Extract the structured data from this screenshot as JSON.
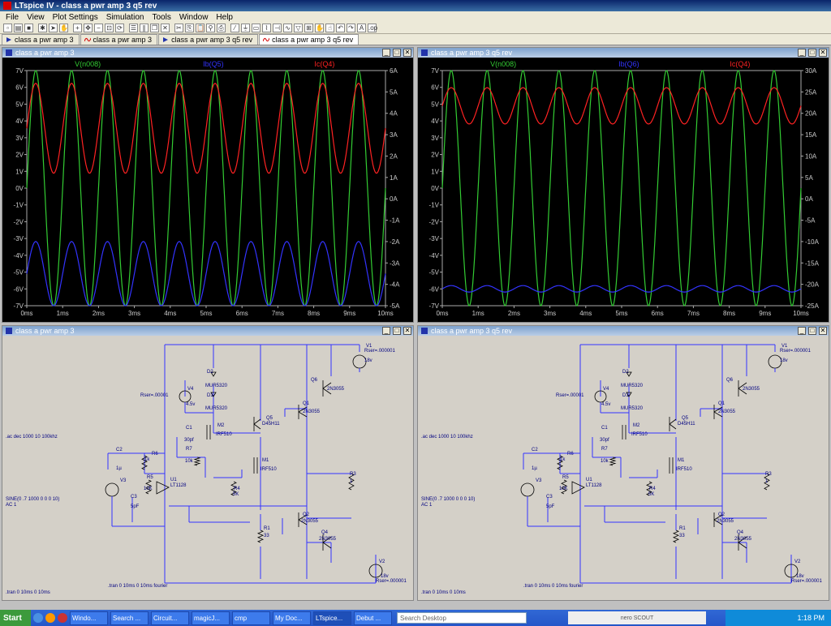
{
  "window": {
    "title": "LTspice IV - class a pwr amp 3 q5 rev"
  },
  "menu": [
    "File",
    "View",
    "Plot Settings",
    "Simulation",
    "Tools",
    "Window",
    "Help"
  ],
  "tabs": [
    {
      "label": "class a pwr amp 3",
      "active": false
    },
    {
      "label": "class a pwr amp 3",
      "active": false
    },
    {
      "label": "class a pwr amp 3 q5 rev",
      "active": false
    },
    {
      "label": "class a pwr amp 3 q5 rev",
      "active": true
    }
  ],
  "panes": {
    "plot_left": {
      "title": "class a pwr amp 3"
    },
    "plot_right": {
      "title": "class a pwr amp 3 q5 rev"
    },
    "schem_left": {
      "title": "class a pwr amp 3"
    },
    "schem_right": {
      "title": "class a pwr amp 3 q5 rev"
    }
  },
  "colors": {
    "green": "#33cc33",
    "blue": "#3333ff",
    "red": "#ff2222",
    "wire": "#3333ff",
    "text": "#000080"
  },
  "chart_data": [
    {
      "type": "line",
      "trace_labels": [
        "V(n008)",
        "Ib(Q5)",
        "Ic(Q4)"
      ],
      "x_ticks": [
        "0ms",
        "1ms",
        "2ms",
        "3ms",
        "4ms",
        "5ms",
        "6ms",
        "7ms",
        "8ms",
        "9ms",
        "10ms"
      ],
      "xlim": [
        0,
        10
      ],
      "y_left_ticks": [
        "7V",
        "6V",
        "5V",
        "4V",
        "3V",
        "2V",
        "1V",
        "0V",
        "-1V",
        "-2V",
        "-3V",
        "-4V",
        "-5V",
        "-6V",
        "-7V"
      ],
      "ylim_left": [
        -7,
        7
      ],
      "y_right_ticks": [
        "6A",
        "5A",
        "4A",
        "3A",
        "2A",
        "1A",
        "0A",
        "-1A",
        "-2A",
        "-3A",
        "-4A",
        "-5A"
      ],
      "ylim_right": [
        -5,
        6
      ],
      "series": [
        {
          "name": "V(n008)",
          "axis": "left",
          "freq_cycles": 10,
          "amplitude": 7,
          "offset": 0
        },
        {
          "name": "Ib(Q5)",
          "axis": "right",
          "freq_cycles": 10,
          "min": -5,
          "max": -2
        },
        {
          "name": "Ic(Q4)",
          "axis": "right",
          "freq_cycles": 10,
          "min": 1.2,
          "max": 5.4
        }
      ]
    },
    {
      "type": "line",
      "trace_labels": [
        "V(n008)",
        "Ib(Q6)",
        "Ic(Q4)"
      ],
      "x_ticks": [
        "0ms",
        "1ms",
        "2ms",
        "3ms",
        "4ms",
        "5ms",
        "6ms",
        "7ms",
        "8ms",
        "9ms",
        "10ms"
      ],
      "xlim": [
        0,
        10
      ],
      "y_left_ticks": [
        "7V",
        "6V",
        "5V",
        "4V",
        "3V",
        "2V",
        "1V",
        "0V",
        "-1V",
        "-2V",
        "-3V",
        "-4V",
        "-5V",
        "-6V",
        "-7V"
      ],
      "ylim_left": [
        -7,
        7
      ],
      "y_right_ticks": [
        "30A",
        "25A",
        "20A",
        "15A",
        "10A",
        "5A",
        "0A",
        "-5A",
        "-10A",
        "-15A",
        "-20A",
        "-25A"
      ],
      "ylim_right": [
        -25,
        30
      ],
      "series": [
        {
          "name": "V(n008)",
          "axis": "left",
          "freq_cycles": 10,
          "amplitude": 7,
          "offset": 0
        },
        {
          "name": "Ib(Q6)",
          "axis": "right",
          "freq_cycles": 10,
          "min": -21.8,
          "max": -20.3
        },
        {
          "name": "Ic(Q4)",
          "axis": "right",
          "freq_cycles": 10,
          "min": 17.5,
          "max": 26
        }
      ]
    }
  ],
  "schematic": {
    "labels": {
      "v1": "V1",
      "v1_rser": "Rser=.000001",
      "v1_val": "18v",
      "v2": "V2",
      "v2_val": "18v",
      "v2_rser": "Rser=.000001",
      "v3": "V3",
      "v4": "V4",
      "v4_val": "4.5v",
      "rser_v4": "Rser=.00001",
      "d2": "D2",
      "d2_part": "MUR5320",
      "d1": "D1",
      "d1_part": "MUR5320",
      "q5": "Q5",
      "q5_part": "D45H11",
      "q6": "Q6",
      "q6_part": "2N3055",
      "q1": "Q1",
      "q1_part": "2N3055",
      "q2": "Q2",
      "q2_part": "2N3055",
      "q4": "Q4",
      "q4_part": "2N3055",
      "m1": "M1",
      "m1_part": "IRF510",
      "m2": "M2",
      "m2_part": "IRF510",
      "c1": "C1",
      "c1_val": "30pf",
      "r7": "R7",
      "r7_val": "10k",
      "r6": "R6",
      "r6_val": "1k",
      "r5": "R5",
      "r5_val": "10K",
      "r4": "R4",
      "r4_val": "5K",
      "r3": "R3",
      "r3_val": "1",
      "r1": "R1",
      "r1_val": "33",
      "c2": "C2",
      "c2_val": "1µ",
      "c3": "C3",
      "c3_val": "5pF",
      "u1": "U1",
      "u1_part": "LT1128",
      "ac_cmd": ".ac dec 1000 10 100khz",
      "sine": "SINE(0 .7 1000 0 0 0 10)",
      "ac1": "AC 1",
      "tran_left": ".tran 0 10ms 0 10ms",
      "tran_four": ".tran 0 10ms 0 10ms fourier"
    }
  },
  "taskbar": {
    "start": "Start",
    "tasks": [
      "Windo...",
      "Search ...",
      "Circuit...",
      "magicJ...",
      "cmp",
      "My Doc...",
      "LTspice...",
      "Debut ..."
    ],
    "search_placeholder": "Search Desktop",
    "nero": "nero SCOUT",
    "clock": "1:18 PM"
  }
}
